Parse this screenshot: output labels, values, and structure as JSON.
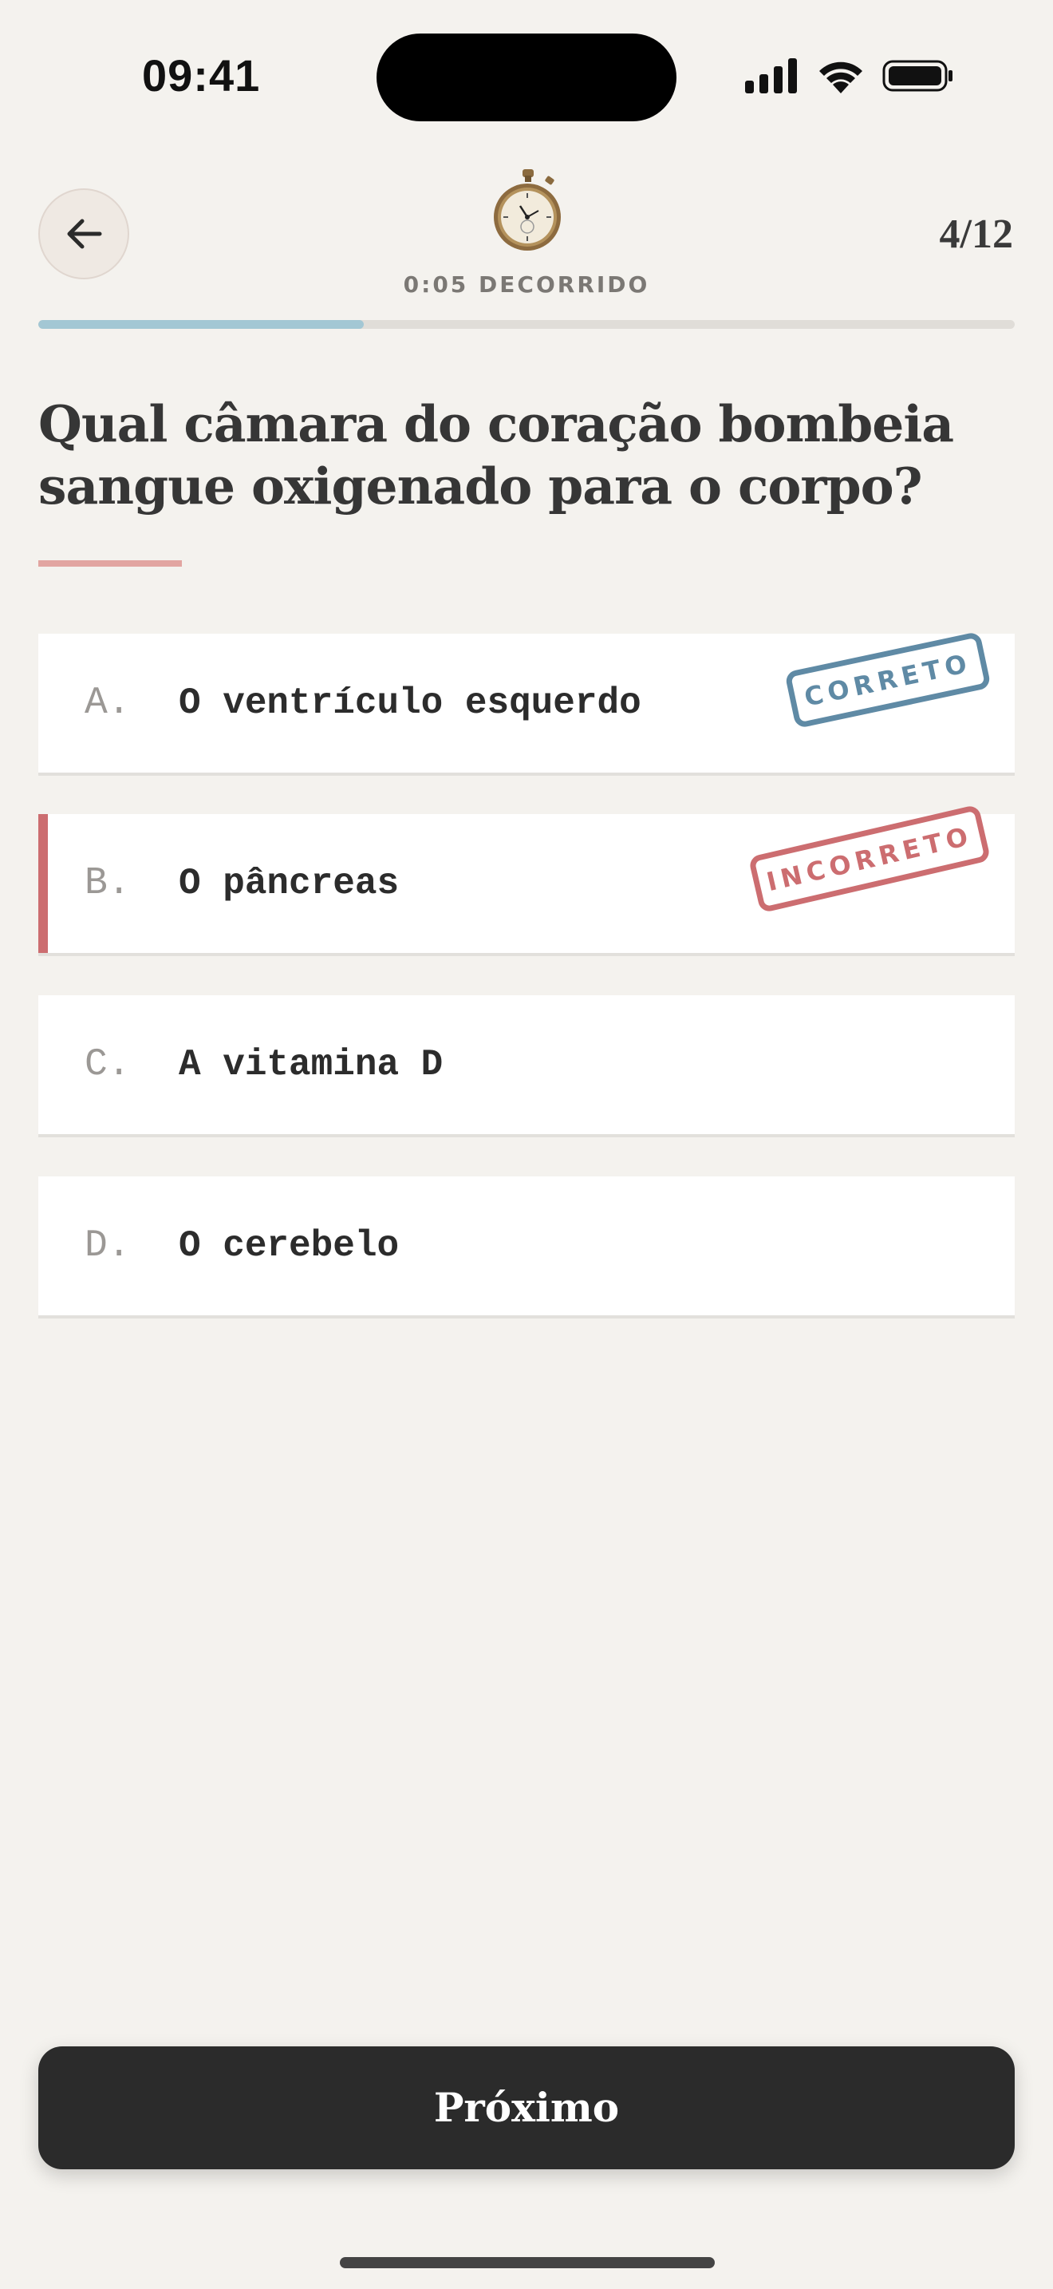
{
  "status_bar": {
    "time": "09:41"
  },
  "header": {
    "elapsed": "0:05 DECORRIDO",
    "counter": "4/12",
    "progress": 0.333
  },
  "question": {
    "text": "Qual câmara do coração bombeia sangue oxigenado para o corpo?"
  },
  "options": [
    {
      "letter": "A.",
      "text": "O ventrículo esquerdo",
      "stamp": "CORRETO"
    },
    {
      "letter": "B.",
      "text": "O pâncreas",
      "stamp": "INCORRETO"
    },
    {
      "letter": "C.",
      "text": "A vitamina D"
    },
    {
      "letter": "D.",
      "text": "O cerebelo"
    }
  ],
  "footer": {
    "next_label": "Próximo"
  },
  "colors": {
    "correct": "#5f8aa5",
    "incorrect": "#cc6d70",
    "progress": "#a3c7d4"
  },
  "icons": {
    "back": "arrow-left-icon",
    "timer": "stopwatch-icon",
    "signal": "cellular-signal-icon",
    "wifi": "wifi-icon",
    "battery": "battery-icon"
  }
}
